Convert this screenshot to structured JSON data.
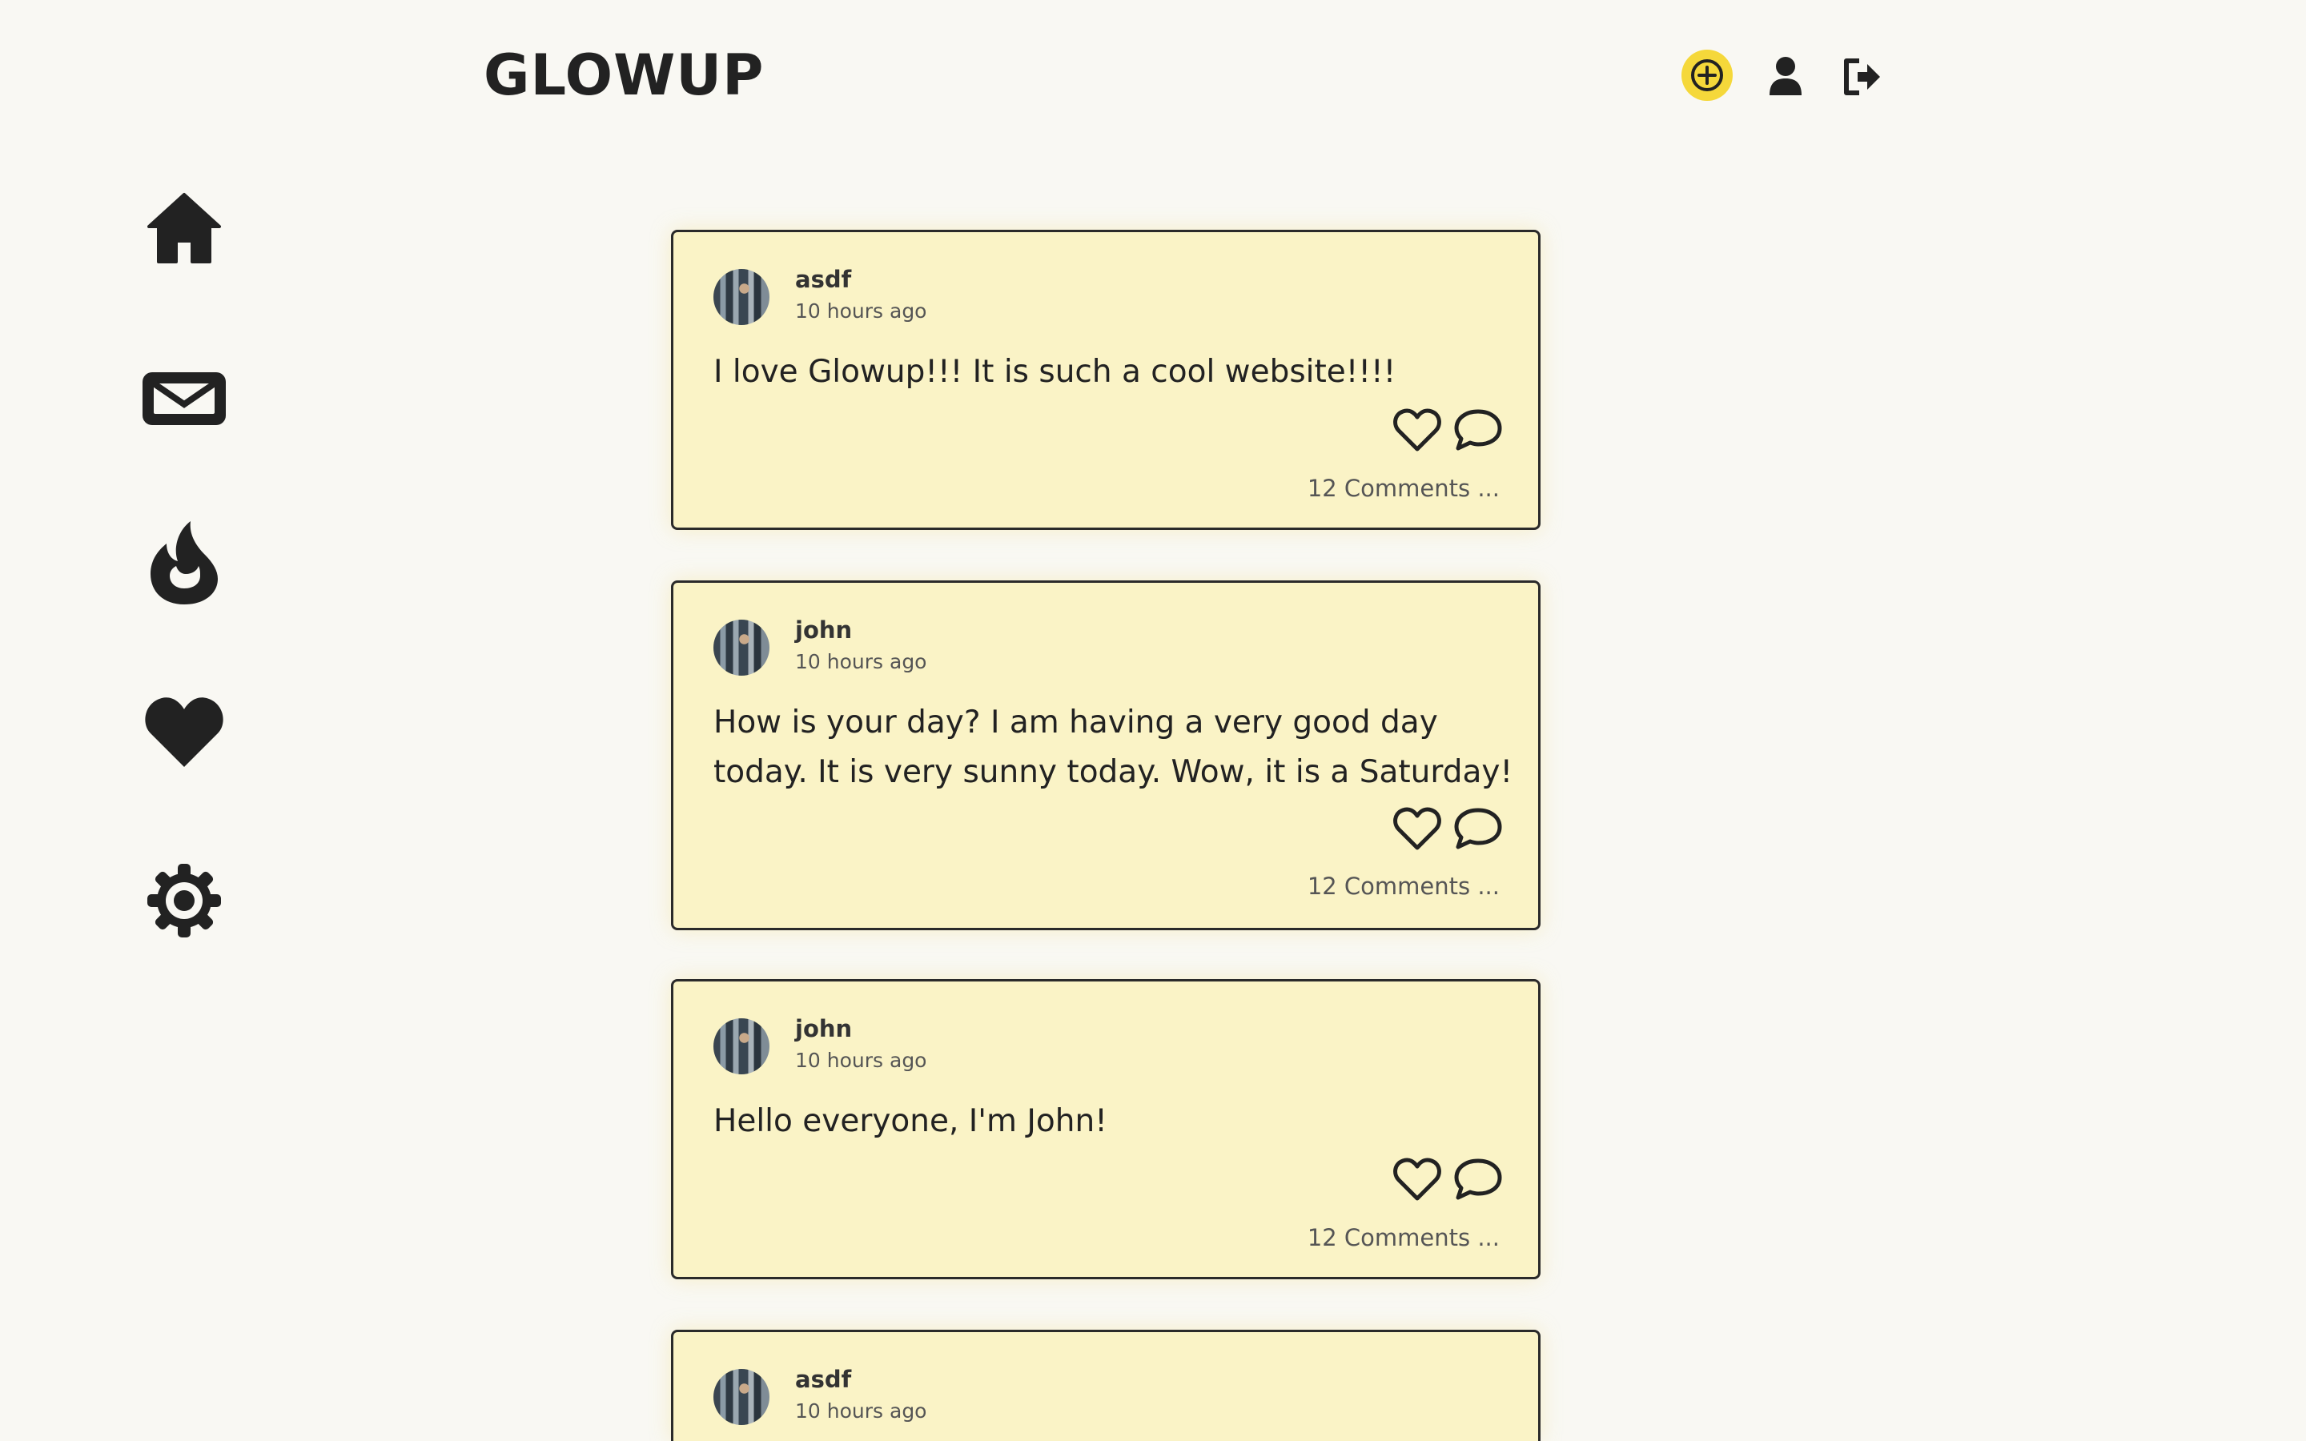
{
  "app": {
    "title": "GLOWUP"
  },
  "header": {
    "icons": [
      "add-icon",
      "user-icon",
      "logout-icon"
    ],
    "accent": "#f5d83a"
  },
  "sidebar": {
    "items": [
      {
        "icon": "home-icon"
      },
      {
        "icon": "mail-icon"
      },
      {
        "icon": "fire-icon"
      },
      {
        "icon": "heart-icon"
      },
      {
        "icon": "gear-icon"
      }
    ]
  },
  "posts": [
    {
      "username": "asdf",
      "time": "10 hours ago",
      "text": "I love Glowup!!! It is such a cool website!!!!",
      "comments": "12 Comments ..."
    },
    {
      "username": "john",
      "time": "10 hours ago",
      "text": "How is your day? I am having a very good day today. It is very sunny today. Wow, it is a Saturday!",
      "comments": "12 Comments ..."
    },
    {
      "username": "john",
      "time": "10 hours ago",
      "text": "Hello everyone, I'm John!",
      "comments": "12 Comments ..."
    },
    {
      "username": "asdf",
      "time": "10 hours ago",
      "text": "",
      "comments": ""
    }
  ],
  "colors": {
    "background": "#f9f8f3",
    "card": "#faf3c6",
    "border": "#2a2a2a"
  }
}
